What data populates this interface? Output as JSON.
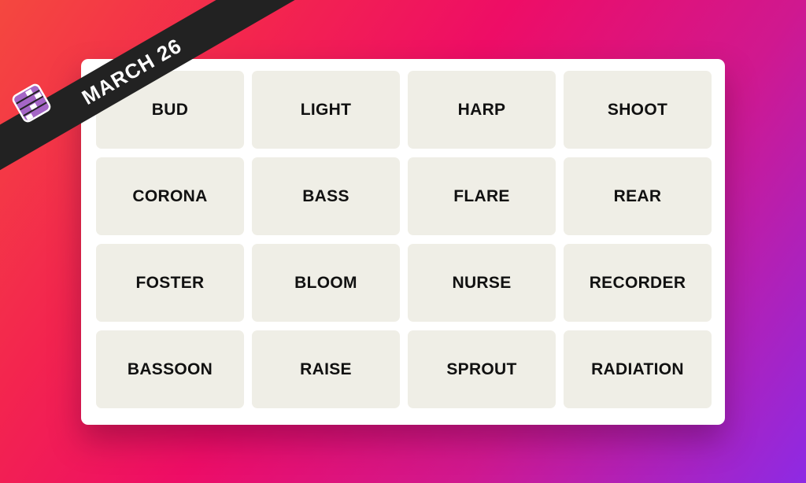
{
  "banner": {
    "date": "MARCH 26",
    "icon": "connections-grid-icon"
  },
  "tiles": [
    "BUD",
    "LIGHT",
    "HARP",
    "SHOOT",
    "CORONA",
    "BASS",
    "FLARE",
    "REAR",
    "FOSTER",
    "BLOOM",
    "NURSE",
    "RECORDER",
    "BASSOON",
    "RAISE",
    "SPROUT",
    "RADIATION"
  ],
  "colors": {
    "tile": "#efeee6",
    "banner": "#222222",
    "icon": "#a566c6"
  }
}
